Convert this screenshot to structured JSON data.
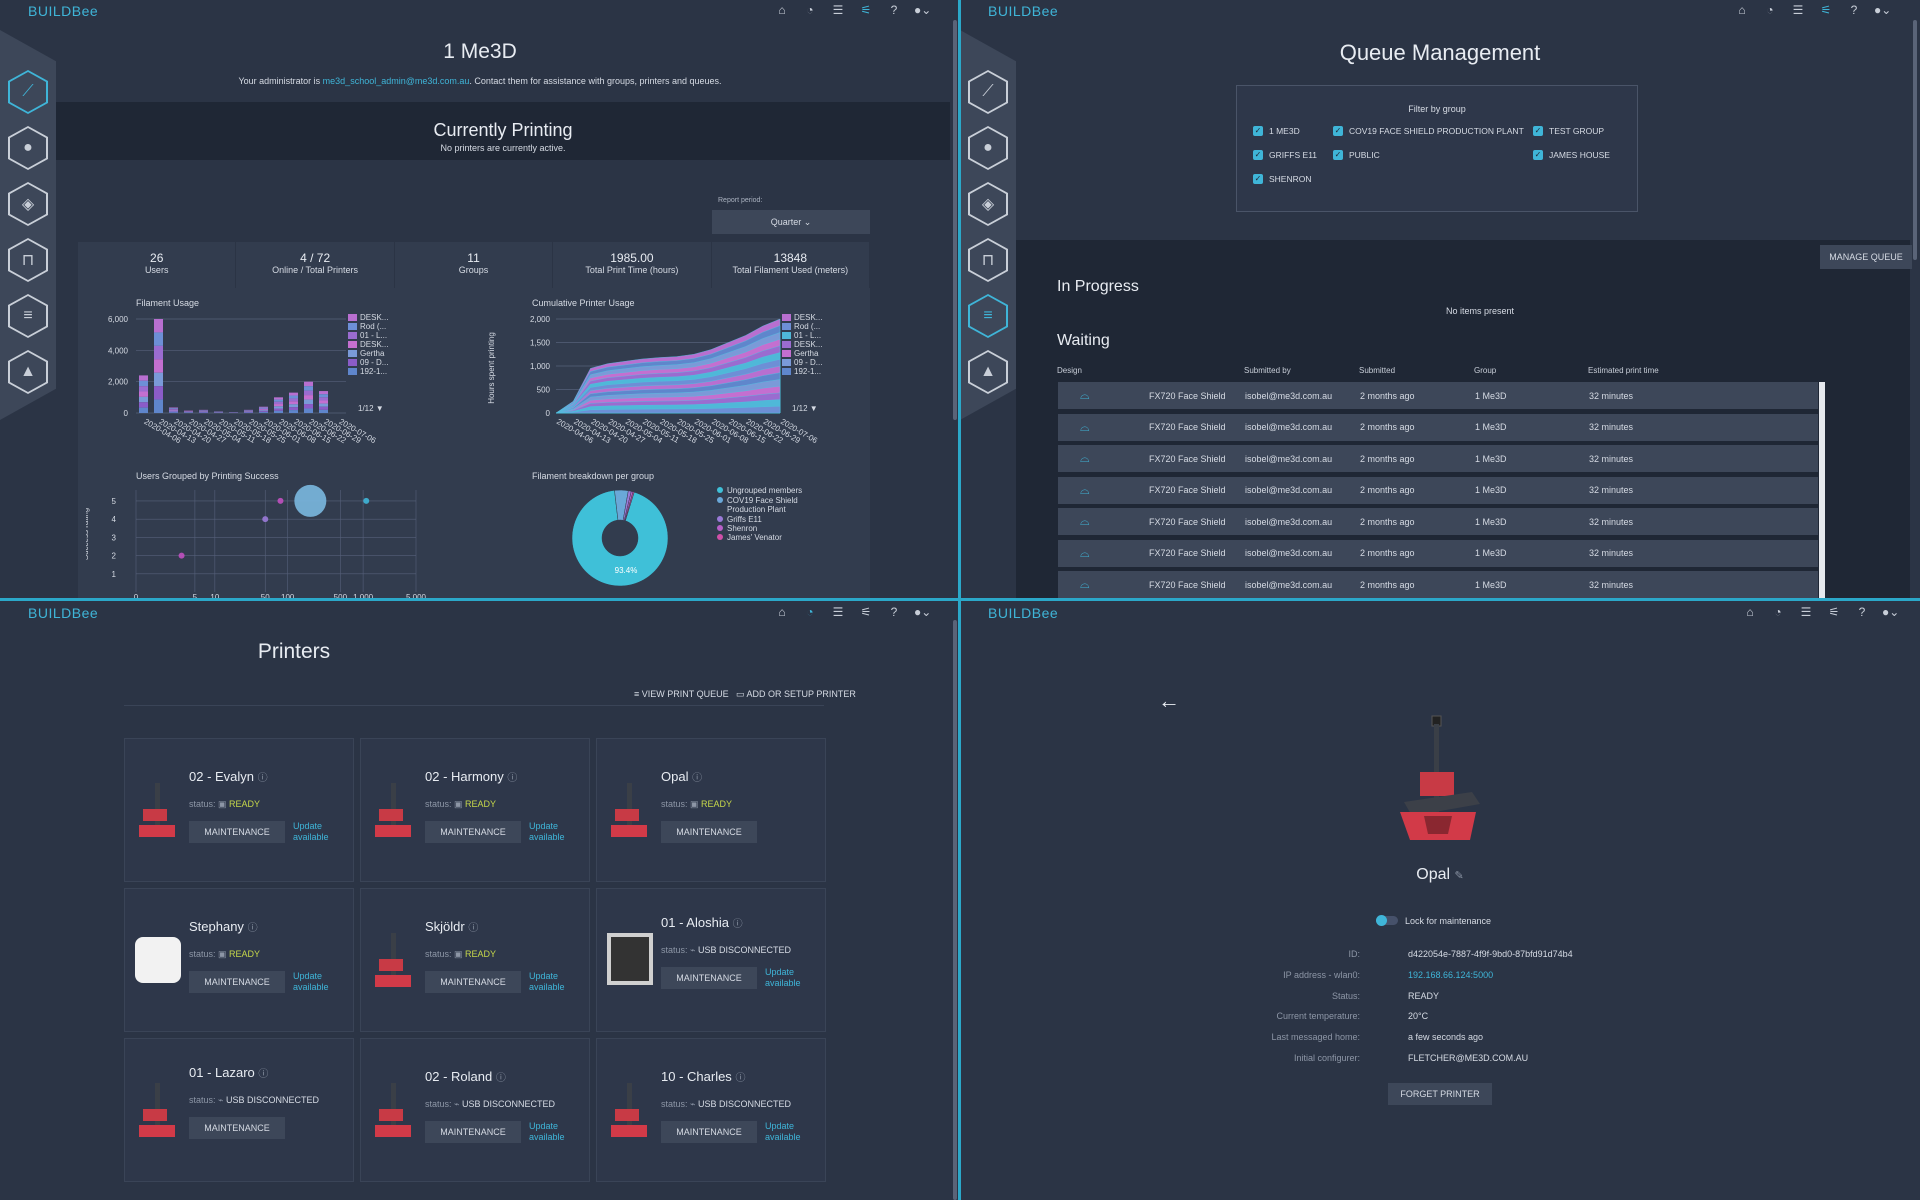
{
  "app": {
    "logo": "BUILDBee"
  },
  "nav_icons": [
    "home-icon",
    "explore-icon",
    "list-icon",
    "sliders-icon",
    "help-icon",
    "account-icon"
  ],
  "sidebar_icons": [
    "chart-line-icon",
    "user-icon",
    "shield-icon",
    "printer-icon",
    "list-icon",
    "graduation-cap-icon"
  ],
  "dashboard": {
    "title": "1 Me3D",
    "admin_prefix": "Your administrator is ",
    "admin_email": "me3d_school_admin@me3d.com.au",
    "admin_suffix": ". Contact them for assistance with groups, printers and queues.",
    "currently_printing": "Currently Printing",
    "no_printers": "No printers are currently active.",
    "report_period_label": "Report period:",
    "report_period_value": "Quarter ⌄",
    "stats": [
      {
        "value": "26",
        "label": "Users"
      },
      {
        "value": "4 / 72",
        "label": "Online / Total Printers"
      },
      {
        "value": "11",
        "label": "Groups"
      },
      {
        "value": "1985.00",
        "label": "Total Print Time (hours)"
      },
      {
        "value": "13848",
        "label": "Total Filament Used (meters)"
      }
    ],
    "pager": "1/12 ▼"
  },
  "chart_data": [
    {
      "type": "bar",
      "title": "Filament Usage",
      "categories": [
        "2020-04-06",
        "2020-04-13",
        "2020-04-20",
        "2020-04-27",
        "2020-05-04",
        "2020-05-11",
        "2020-05-18",
        "2020-05-25",
        "2020-06-01",
        "2020-06-08",
        "2020-06-15",
        "2020-06-22",
        "2020-06-29",
        "2020-07-06"
      ],
      "x_tick_labels": [
        "2020-04-06",
        "2020-04-13",
        "2020-04-20",
        "2020-04-27",
        "2020-05-04",
        "2020-05-11",
        "2020-05-18",
        "2020-05-25",
        "2020-06-01",
        "2020-06-08",
        "2020-06-15",
        "2020-06-22",
        "2020-06-29",
        "2020-07-06"
      ],
      "values": [
        2400,
        6000,
        350,
        150,
        200,
        100,
        50,
        200,
        400,
        1000,
        1300,
        2000,
        1400,
        0
      ],
      "ylim": [
        0,
        6000
      ],
      "yticks": [
        0,
        2000,
        4000,
        6000
      ],
      "y_tick_labels": [
        "0",
        "2,000",
        "4,000",
        "6,000"
      ],
      "legend": [
        "DESK...",
        "Rod (...",
        "01 - L...",
        "DESK...",
        "Gertha",
        "09 - D...",
        "192-1..."
      ],
      "colors": [
        "#b86fd0",
        "#6d8fd6",
        "#9a6cd0",
        "#c46fd0",
        "#7a9ad8",
        "#8b5cc8",
        "#5f86cc"
      ]
    },
    {
      "type": "area",
      "title": "Cumulative Printer Usage",
      "ylabel": "Hours spent printing",
      "x": [
        "2020-04-06",
        "2020-04-13",
        "2020-04-20",
        "2020-04-27",
        "2020-05-04",
        "2020-05-11",
        "2020-05-18",
        "2020-05-25",
        "2020-06-01",
        "2020-06-08",
        "2020-06-15",
        "2020-06-22",
        "2020-06-29",
        "2020-07-06"
      ],
      "x_tick_labels": [
        "2020-04-06",
        "2020-04-13",
        "2020-04-20",
        "2020-04-27",
        "2020-05-04",
        "2020-05-11",
        "2020-05-18",
        "2020-05-25",
        "2020-06-01",
        "2020-06-08",
        "2020-06-15",
        "2020-06-22",
        "2020-06-29",
        "2020-07-06"
      ],
      "total": [
        0,
        250,
        950,
        1050,
        1100,
        1150,
        1180,
        1200,
        1250,
        1350,
        1500,
        1650,
        1850,
        2000
      ],
      "ylim": [
        0,
        2000
      ],
      "yticks": [
        0,
        500,
        1000,
        1500,
        2000
      ],
      "y_tick_labels": [
        "0",
        "500",
        "1,000",
        "1,500",
        "2,000"
      ],
      "legend": [
        "DESK...",
        "Rod (...",
        "01 - L...",
        "DESK...",
        "Gertha",
        "09 - D...",
        "192-1..."
      ]
    },
    {
      "type": "scatter",
      "title": "Users Grouped by Printing Success",
      "ylabel": "Success rating",
      "xscale": "log",
      "xlim": [
        0,
        5000
      ],
      "xticks": [
        0,
        5,
        10,
        50,
        100,
        500,
        1000,
        5000
      ],
      "x_tick_labels": [
        "0",
        "5",
        "10",
        "50",
        "100",
        "500",
        "1,000",
        "5,000"
      ],
      "ylim": [
        1,
        5
      ],
      "yticks": [
        1,
        2,
        3,
        4,
        5
      ],
      "points": [
        {
          "x": 3,
          "y": 2,
          "size": 3,
          "color": "#c050c0"
        },
        {
          "x": 50,
          "y": 4,
          "size": 3,
          "color": "#9a7ad8"
        },
        {
          "x": 80,
          "y": 5,
          "size": 3,
          "color": "#c050c0"
        },
        {
          "x": 200,
          "y": 5,
          "size": 16,
          "color": "#7ab8e0"
        },
        {
          "x": 1100,
          "y": 5,
          "size": 3,
          "color": "#3fb5d8"
        }
      ]
    },
    {
      "type": "pie",
      "title": "Filament breakdown per group",
      "labels": [
        "Ungrouped members",
        "COV19 Face Shield Production Plant",
        "Griffs E11",
        "Shenron",
        "James' Venator"
      ],
      "values": [
        93.4,
        4.6,
        1.0,
        0.6,
        0.4
      ],
      "colors": [
        "#3fc0d8",
        "#6aa8d8",
        "#9a7ad8",
        "#b860c8",
        "#d050a8"
      ],
      "slice_label": "93.4%"
    }
  ],
  "queue": {
    "title": "Queue Management",
    "filter_title": "Filter by group",
    "groups": [
      "1 ME3D",
      "COV19 FACE SHIELD PRODUCTION PLANT",
      "TEST GROUP",
      "GRIFFS E11",
      "PUBLIC",
      "JAMES HOUSE",
      "SHENRON"
    ],
    "manage_button": "MANAGE QUEUE",
    "in_progress": "In Progress",
    "no_items": "No items present",
    "waiting": "Waiting",
    "columns": [
      "Design",
      "Submitted by",
      "Submitted",
      "Group",
      "Estimated print time"
    ],
    "rows": [
      {
        "design": "FX720 Face Shield",
        "by": "isobel@me3d.com.au",
        "when": "2 months ago",
        "group": "1 Me3D",
        "time": "32 minutes"
      },
      {
        "design": "FX720 Face Shield",
        "by": "isobel@me3d.com.au",
        "when": "2 months ago",
        "group": "1 Me3D",
        "time": "32 minutes"
      },
      {
        "design": "FX720 Face Shield",
        "by": "isobel@me3d.com.au",
        "when": "2 months ago",
        "group": "1 Me3D",
        "time": "32 minutes"
      },
      {
        "design": "FX720 Face Shield",
        "by": "isobel@me3d.com.au",
        "when": "2 months ago",
        "group": "1 Me3D",
        "time": "32 minutes"
      },
      {
        "design": "FX720 Face Shield",
        "by": "isobel@me3d.com.au",
        "when": "2 months ago",
        "group": "1 Me3D",
        "time": "32 minutes"
      },
      {
        "design": "FX720 Face Shield",
        "by": "isobel@me3d.com.au",
        "when": "2 months ago",
        "group": "1 Me3D",
        "time": "32 minutes"
      },
      {
        "design": "FX720 Face Shield",
        "by": "isobel@me3d.com.au",
        "when": "2 months ago",
        "group": "1 Me3D",
        "time": "32 minutes"
      }
    ]
  },
  "printers": {
    "title": "Printers",
    "view_queue": "VIEW PRINT QUEUE",
    "add_printer": "ADD OR SETUP PRINTER",
    "status_label": "status:",
    "maintenance": "MAINTENANCE",
    "update": "Update available",
    "cards": [
      {
        "name": "02 - Evalyn",
        "status": "READY",
        "update": true,
        "kind": "red"
      },
      {
        "name": "02 - Harmony",
        "status": "READY",
        "update": true,
        "kind": "red"
      },
      {
        "name": "Opal",
        "status": "READY",
        "update": false,
        "kind": "red"
      },
      {
        "name": "Stephany",
        "status": "READY",
        "update": true,
        "kind": "white"
      },
      {
        "name": "Skjöldr",
        "status": "READY",
        "update": true,
        "kind": "red"
      },
      {
        "name": "01 - Aloshia",
        "status": "USB DISCONNECTED",
        "update": true,
        "kind": "frame"
      },
      {
        "name": "01 - Lazaro",
        "status": "USB DISCONNECTED",
        "update": false,
        "kind": "red"
      },
      {
        "name": "02 - Roland",
        "status": "USB DISCONNECTED",
        "update": true,
        "kind": "red"
      },
      {
        "name": "10 - Charles",
        "status": "USB DISCONNECTED",
        "update": true,
        "kind": "red"
      }
    ]
  },
  "detail": {
    "name": "Opal",
    "lock_label": "Lock for maintenance",
    "fields": [
      {
        "k": "ID:",
        "v": "d422054e-7887-4f9f-9bd0-87bfd91d74b4",
        "link": false
      },
      {
        "k": "IP address - wlan0:",
        "v": "192.168.66.124:5000",
        "link": true
      },
      {
        "k": "Status:",
        "v": "READY",
        "link": false
      },
      {
        "k": "Current temperature:",
        "v": "20°C",
        "link": false
      },
      {
        "k": "Last messaged home:",
        "v": "a few seconds ago",
        "link": false
      },
      {
        "k": "Initial configurer:",
        "v": "FLETCHER@ME3D.COM.AU",
        "link": false
      }
    ],
    "forget": "FORGET PRINTER"
  }
}
